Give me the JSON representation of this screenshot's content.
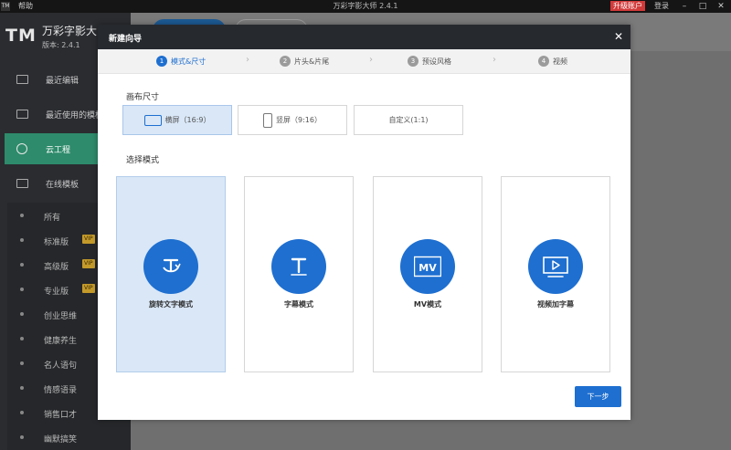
{
  "titlebar": {
    "logo": "TM",
    "help": "帮助",
    "title": "万彩字影大师 2.4.1",
    "upgrade": "升级账户",
    "login": "登录",
    "minimize": "–",
    "maximize": "□",
    "close": "✕"
  },
  "sidebar": {
    "logo": "TM",
    "app_name": "万彩字影大师",
    "version": "版本: 2.4.1",
    "nav": [
      {
        "label": "最近编辑"
      },
      {
        "label": "最近使用的模板"
      },
      {
        "label": "云工程"
      },
      {
        "label": "在线模板"
      }
    ],
    "sub_items": [
      {
        "label": "所有"
      },
      {
        "label": "标准版",
        "badge": "VIP"
      },
      {
        "label": "高级版",
        "badge": "VIP"
      },
      {
        "label": "专业版",
        "badge": "VIP"
      },
      {
        "label": "创业思维"
      },
      {
        "label": "健康养生"
      },
      {
        "label": "名人语句"
      },
      {
        "label": "情感语录"
      },
      {
        "label": "销售口才"
      },
      {
        "label": "幽默搞笑"
      }
    ]
  },
  "modal": {
    "title": "新建向导",
    "close": "✕",
    "steps": [
      {
        "num": "1",
        "label": "模式&尺寸"
      },
      {
        "num": "2",
        "label": "片头&片尾"
      },
      {
        "num": "3",
        "label": "预设风格"
      },
      {
        "num": "4",
        "label": "视频"
      }
    ],
    "arrow": "›",
    "canvas_size_label": "画布尺寸",
    "sizes": [
      {
        "label": "横屏（16:9）",
        "icon": "landscape-screen-icon"
      },
      {
        "label": "竖屏（9:16）",
        "icon": "portrait-screen-icon"
      },
      {
        "label": "自定义(1:1)"
      }
    ],
    "mode_label": "选择模式",
    "modes": [
      {
        "label": "旋转文字模式",
        "icon": "rotate-text-icon"
      },
      {
        "label": "字幕模式",
        "icon": "text-t-icon"
      },
      {
        "label": "MV模式",
        "icon": "mv-icon",
        "icon_text": "MV"
      },
      {
        "label": "视频加字幕",
        "icon": "video-play-icon"
      }
    ],
    "next": "下一步"
  },
  "colors": {
    "accent": "#1e6fd0",
    "selected_bg": "#d9e7f7",
    "sidebar_bg": "#2a2c30",
    "active_nav": "#2e8b6b",
    "upgrade": "#d23a3a",
    "vip": "#c49a2a"
  }
}
